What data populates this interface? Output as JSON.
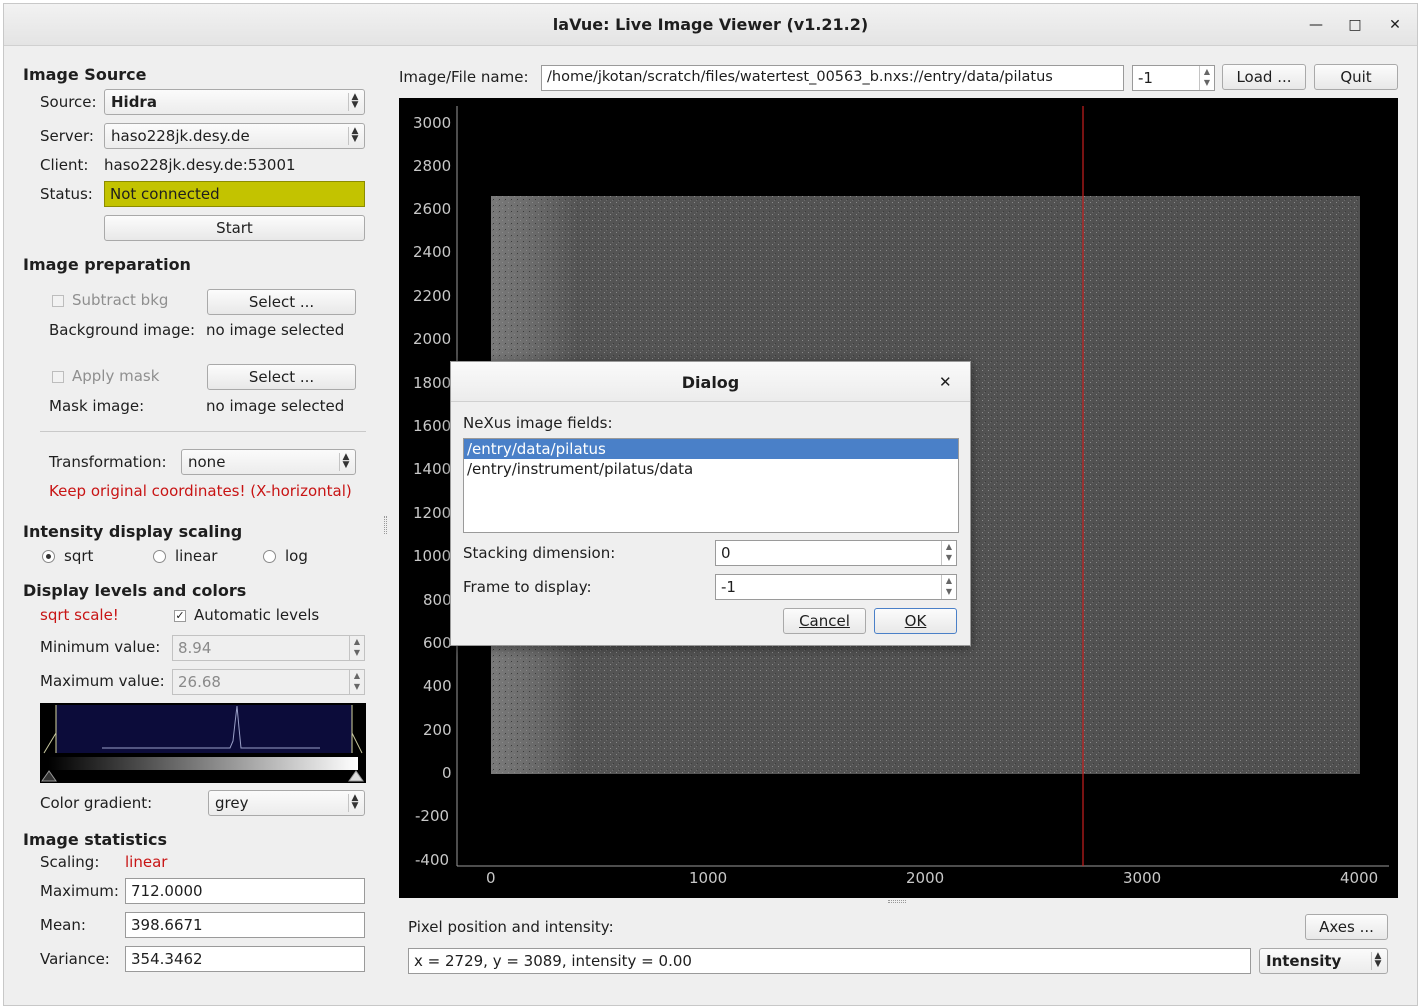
{
  "window": {
    "title": "laVue: Live Image Viewer (v1.21.2)",
    "minimize_icon": "minimize-icon",
    "maximize_icon": "maximize-icon",
    "close_icon": "close-icon"
  },
  "image_source": {
    "heading": "Image Source",
    "source_label": "Source:",
    "source_value": "Hidra",
    "server_label": "Server:",
    "server_value": "haso228jk.desy.de",
    "client_label": "Client:",
    "client_value": "haso228jk.desy.de:53001",
    "status_label": "Status:",
    "status_value": "Not connected",
    "status_color": "#c3c300",
    "start_button": "Start"
  },
  "image_preparation": {
    "heading": "Image preparation",
    "subtract_bkg_label": "Subtract bkg",
    "select_button_1": "Select ...",
    "background_image_label": "Background image:",
    "background_image_value": "no image selected",
    "apply_mask_label": "Apply mask",
    "select_button_2": "Select ...",
    "mask_image_label": "Mask image:",
    "mask_image_value": "no image selected",
    "transformation_label": "Transformation:",
    "transformation_value": "none",
    "warning": "Keep original coordinates! (X-horizontal)"
  },
  "intensity_scaling": {
    "heading": "Intensity display scaling",
    "options": [
      "sqrt",
      "linear",
      "log"
    ],
    "selected": "sqrt"
  },
  "display_levels": {
    "heading": "Display levels and colors",
    "scale_note": "sqrt scale!",
    "automatic_levels_label": "Automatic levels",
    "automatic_levels_checked": true,
    "min_label": "Minimum value:",
    "min_value": "8.94",
    "max_label": "Maximum value:",
    "max_value": "26.68",
    "color_gradient_label": "Color gradient:",
    "color_gradient_value": "grey"
  },
  "image_statistics": {
    "heading": "Image statistics",
    "scaling_label": "Scaling:",
    "scaling_value": "linear",
    "maximum_label": "Maximum:",
    "maximum_value": "712.0000",
    "mean_label": "Mean:",
    "mean_value": "398.6671",
    "variance_label": "Variance:",
    "variance_value": "354.3462"
  },
  "file_bar": {
    "label": "Image/File name:",
    "path": "/home/jkotan/scratch/files/watertest_00563_b.nxs://entry/data/pilatus",
    "frame": "-1",
    "load_button": "Load ...",
    "quit_button": "Quit"
  },
  "plot": {
    "y_ticks": [
      "3000",
      "2800",
      "2600",
      "2400",
      "2200",
      "2000",
      "1800",
      "1600",
      "1400",
      "1200",
      "1000",
      "800",
      "600",
      "400",
      "200",
      "0",
      "-200",
      "-400"
    ],
    "x_ticks": [
      "0",
      "1000",
      "2000",
      "3000",
      "4000"
    ],
    "crosshair_color": "#c81e1e"
  },
  "bottom": {
    "pixel_label": "Pixel position and intensity:",
    "axes_button": "Axes ...",
    "pixel_info": "x = 2729, y = 3089, intensity = 0.00",
    "mode_value": "Intensity"
  },
  "dialog": {
    "title": "Dialog",
    "fields_label": "NeXus image fields:",
    "fields": [
      "/entry/data/pilatus",
      "/entry/instrument/pilatus/data"
    ],
    "selected_field": "/entry/data/pilatus",
    "stacking_label": "Stacking dimension:",
    "stacking_value": "0",
    "frame_label": "Frame to display:",
    "frame_value": "-1",
    "cancel_button": "Cancel",
    "ok_button": "OK"
  }
}
